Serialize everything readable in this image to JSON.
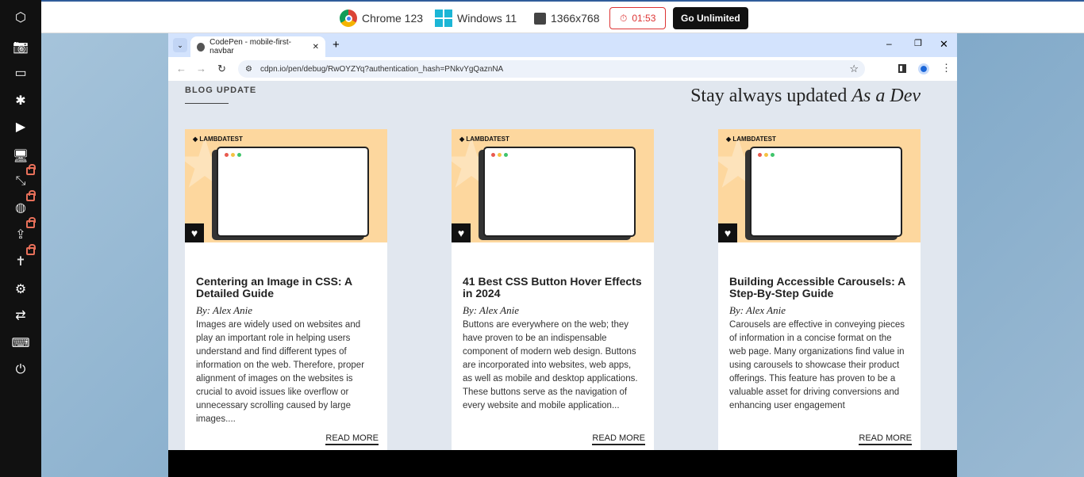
{
  "topbar": {
    "browser": "Chrome 123",
    "os": "Windows 11",
    "resolution": "1366x768",
    "timer": "01:53",
    "cta": "Go Unlimited"
  },
  "sidebar": {
    "items": [
      {
        "icon": "lambdatest-logo-icon"
      },
      {
        "icon": "camera-icon"
      },
      {
        "icon": "video-icon"
      },
      {
        "icon": "bug-icon"
      },
      {
        "icon": "play-icon"
      },
      {
        "icon": "monitor-icon"
      },
      {
        "icon": "resize-icon",
        "locked": true
      },
      {
        "icon": "globe-icon",
        "locked": true
      },
      {
        "icon": "upload-icon",
        "locked": true
      },
      {
        "icon": "accessibility-icon",
        "locked": true
      },
      {
        "icon": "settings-icon"
      },
      {
        "icon": "switch-icon"
      },
      {
        "icon": "keyboard-icon"
      },
      {
        "icon": "power-icon"
      }
    ]
  },
  "browser": {
    "tab_title": "CodePen - mobile-first-navbar",
    "url": "cdpn.io/pen/debug/RwOYZYq?authentication_hash=PNkvYgQaznNA"
  },
  "page": {
    "section_label": "BLOG UPDATE",
    "tagline": "Stay always updated ",
    "tagline_em": "As a Dev",
    "cards": [
      {
        "brand": "LAMBDATEST",
        "title": "Centering an Image in CSS: A Detailed Guide",
        "author": "By: Alex Anie",
        "text": "Images are widely used on websites and play an important role in helping users understand and find different types of information on the web. Therefore, proper alignment of images on the websites is crucial to avoid issues like overflow or unnecessary scrolling caused by large images....",
        "cta": "READ MORE"
      },
      {
        "brand": "LAMBDATEST",
        "title": "41 Best CSS Button Hover Effects in 2024",
        "author": "By: Alex Anie",
        "text": "Buttons are everywhere on the web; they have proven to be an indispensable component of modern web design. Buttons are incorporated into websites, web apps, as well as mobile and desktop applications. These buttons serve as the navigation of every website and mobile application...",
        "cta": "READ MORE"
      },
      {
        "brand": "LAMBDATEST",
        "title": "Building Accessible Carousels: A Step-By-Step Guide",
        "author": "By: Alex Anie",
        "text": "Carousels are effective in conveying pieces of information in a concise format on the web page. Many organizations find value in using carousels to showcase their product offerings. This feature has proven to be a valuable asset for driving conversions and enhancing user engagement",
        "cta": "READ MORE"
      }
    ]
  },
  "colors": {
    "card_image_bg": "#fdd79e",
    "timer": "#dd3333",
    "tabbar": "#d3e3fd"
  }
}
